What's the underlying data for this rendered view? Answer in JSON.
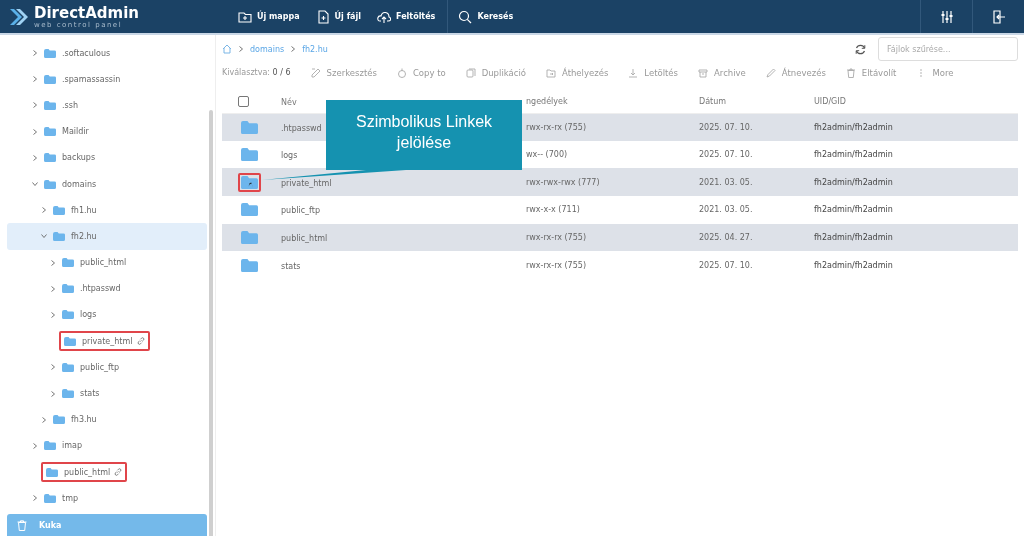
{
  "app": {
    "name": "DirectAdmin",
    "tagline": "web control panel"
  },
  "top_actions": [
    {
      "label": "Új mappa",
      "kind": "folder"
    },
    {
      "label": "Új fájl",
      "kind": "file"
    },
    {
      "label": "Feltöltés",
      "kind": "upload"
    },
    {
      "label": "Keresés",
      "kind": "search"
    }
  ],
  "tree": [
    {
      "label": ".softaculous",
      "expanded": false,
      "link": false,
      "selected": false,
      "annotated": false
    },
    {
      "label": ".spamassassin",
      "expanded": false,
      "link": false,
      "selected": false,
      "annotated": false
    },
    {
      "label": ".ssh",
      "expanded": false,
      "link": false,
      "selected": false,
      "annotated": false
    },
    {
      "label": "Maildir",
      "expanded": false,
      "link": false,
      "selected": false,
      "annotated": false
    },
    {
      "label": "backups",
      "expanded": false,
      "link": false,
      "selected": false,
      "annotated": false
    },
    {
      "label": "domains",
      "expanded": true,
      "link": false,
      "selected": false,
      "annotated": false,
      "children": [
        {
          "label": "fh1.hu",
          "expanded": false,
          "link": false,
          "selected": false,
          "annotated": false
        },
        {
          "label": "fh2.hu",
          "expanded": true,
          "link": false,
          "selected": true,
          "annotated": false,
          "children": [
            {
              "label": "public_html",
              "expanded": false,
              "link": false,
              "selected": false,
              "annotated": false
            },
            {
              "label": ".htpasswd",
              "expanded": false,
              "link": false,
              "selected": false,
              "annotated": false
            },
            {
              "label": "logs",
              "expanded": false,
              "link": false,
              "selected": false,
              "annotated": false
            },
            {
              "label": "private_html",
              "expanded": false,
              "link": true,
              "selected": false,
              "annotated": true
            },
            {
              "label": "public_ftp",
              "expanded": false,
              "link": false,
              "selected": false,
              "annotated": false
            },
            {
              "label": "stats",
              "expanded": false,
              "link": false,
              "selected": false,
              "annotated": false
            }
          ]
        },
        {
          "label": "fh3.hu",
          "expanded": false,
          "link": false,
          "selected": false,
          "annotated": false
        }
      ]
    },
    {
      "label": "imap",
      "expanded": false,
      "link": false,
      "selected": false,
      "annotated": false
    },
    {
      "label": "public_html",
      "expanded": false,
      "link": true,
      "selected": false,
      "annotated": true
    },
    {
      "label": "tmp",
      "expanded": false,
      "link": false,
      "selected": false,
      "annotated": false
    }
  ],
  "trash": {
    "label": "Kuka"
  },
  "breadcrumb": [
    "domains",
    "fh2.hu"
  ],
  "filter": {
    "placeholder": "Fájlok szűrése..."
  },
  "selection": {
    "label": "Kiválasztva:",
    "count": "0 / 6"
  },
  "toolbar": [
    {
      "label": "Szerkesztés",
      "kind": "edit"
    },
    {
      "label": "Copy to",
      "kind": "copy"
    },
    {
      "label": "Duplikáció",
      "kind": "duplicate"
    },
    {
      "label": "Áthelyezés",
      "kind": "move"
    },
    {
      "label": "Letöltés",
      "kind": "download"
    },
    {
      "label": "Archive",
      "kind": "archive"
    },
    {
      "label": "Átnevezés",
      "kind": "rename"
    },
    {
      "label": "Eltávolít",
      "kind": "delete"
    },
    {
      "label": "More",
      "kind": "more"
    }
  ],
  "table": {
    "select_all": {
      "checked": false
    },
    "columns": [
      "Név",
      "ngedélyek",
      "Dátum",
      "UID/GID"
    ],
    "rows": [
      {
        "name": ".htpasswd",
        "permissions": "rwx-rx-rx (755)",
        "date": "2025. 07. 10.",
        "owner": "fh2admin/fh2admin",
        "link": false,
        "annotated": false
      },
      {
        "name": "logs",
        "permissions": "wx-- (700)",
        "date": "2025. 07. 10.",
        "owner": "fh2admin/fh2admin",
        "link": false,
        "annotated": false
      },
      {
        "name": "private_html",
        "permissions": "rwx-rwx-rwx (777)",
        "date": "2021. 03. 05.",
        "owner": "fh2admin/fh2admin",
        "link": true,
        "annotated": true
      },
      {
        "name": "public_ftp",
        "permissions": "rwx-x-x (711)",
        "date": "2021. 03. 05.",
        "owner": "fh2admin/fh2admin",
        "link": false,
        "annotated": false
      },
      {
        "name": "public_html",
        "permissions": "rwx-rx-rx (755)",
        "date": "2025. 04. 27.",
        "owner": "fh2admin/fh2admin",
        "link": false,
        "annotated": false
      },
      {
        "name": "stats",
        "permissions": "rwx-rx-rx (755)",
        "date": "2025. 07. 10.",
        "owner": "fh2admin/fh2admin",
        "link": false,
        "annotated": false
      }
    ]
  },
  "callout": {
    "text": "Szimbolikus Linkek jelölése"
  }
}
